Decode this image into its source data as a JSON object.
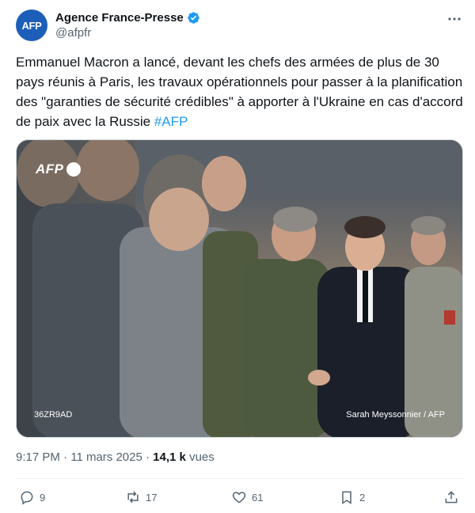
{
  "account": {
    "avatar_text": "AFP",
    "display_name": "Agence France-Presse",
    "handle": "@afpfr",
    "verified_icon": "verified-badge-icon"
  },
  "tweet": {
    "text": "Emmanuel Macron a lancé, devant les chefs des armées de plus de 30 pays réunis à Paris, les travaux opérationnels pour passer à la planification des \"garanties de sécurité crédibles\" à apporter à l'Ukraine en cas d'accord de paix avec la Russie",
    "hashtag": "#AFP"
  },
  "media": {
    "logo_text": "AFP",
    "photo_id": "36ZR9AD",
    "credit": "Sarah Meyssonnier / AFP"
  },
  "meta": {
    "time": "9:17 PM",
    "separator": "·",
    "date": "11 mars 2025",
    "views_count": "14,1 k",
    "views_label": "vues"
  },
  "actions": {
    "replies": "9",
    "reposts": "17",
    "likes": "61",
    "bookmarks": "2"
  },
  "colors": {
    "accent": "#1d9bf0",
    "avatar_bg": "#1d5fb8",
    "secondary_text": "#536471"
  }
}
